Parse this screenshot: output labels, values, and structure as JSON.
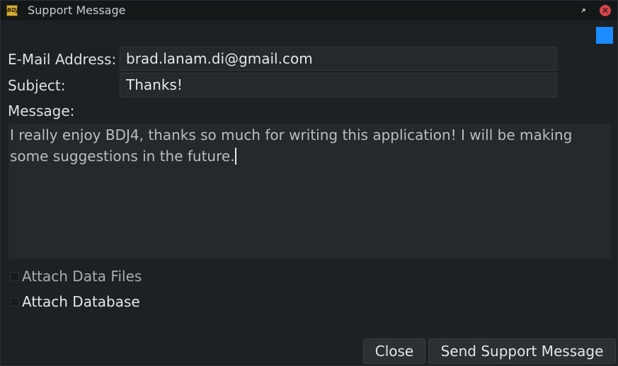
{
  "window": {
    "title": "Support Message",
    "icon": "bdj4-app-icon",
    "indicator_color": "#1a8cff"
  },
  "form": {
    "email_label": "E-Mail Address:",
    "email_value": "brad.lanam.di@gmail.com",
    "subject_label": "Subject:",
    "subject_value": "Thanks!",
    "message_label": "Message:",
    "message_value": "I really enjoy BDJ4, thanks so much for writing this application! I will be making some suggestions in the future."
  },
  "options": {
    "attach_data_files": {
      "label": "Attach Data Files",
      "checked": false
    },
    "attach_database": {
      "label": "Attach Database",
      "checked": false
    }
  },
  "buttons": {
    "close": "Close",
    "send": "Send Support Message"
  }
}
